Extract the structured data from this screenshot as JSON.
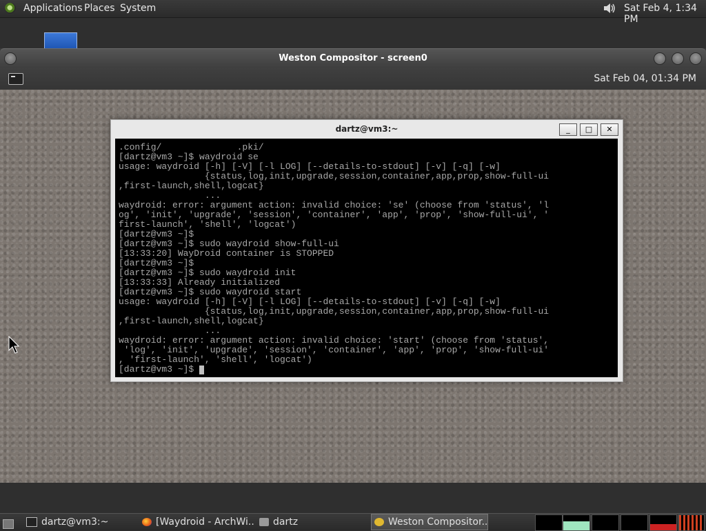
{
  "top_panel": {
    "menus": [
      "Applications",
      "Places",
      "System"
    ],
    "clock": "Sat Feb  4,  1:34 PM"
  },
  "weston": {
    "title": "Weston Compositor - screen0",
    "panel_clock": "Sat Feb 04, 01:34 PM"
  },
  "terminal": {
    "title": "dartz@vm3:~",
    "buttons": {
      "minimize": "_",
      "maximize": "□",
      "close": "✕"
    },
    "lines": [
      ".config/              .pki/",
      "[dartz@vm3 ~]$ waydroid se",
      "usage: waydroid [-h] [-V] [-l LOG] [--details-to-stdout] [-v] [-q] [-w]",
      "                {status,log,init,upgrade,session,container,app,prop,show-full-ui",
      ",first-launch,shell,logcat}",
      "                ...",
      "waydroid: error: argument action: invalid choice: 'se' (choose from 'status', 'l",
      "og', 'init', 'upgrade', 'session', 'container', 'app', 'prop', 'show-full-ui', '",
      "first-launch', 'shell', 'logcat')",
      "[dartz@vm3 ~]$",
      "[dartz@vm3 ~]$ sudo waydroid show-full-ui",
      "[13:33:20] WayDroid container is STOPPED",
      "[dartz@vm3 ~]$",
      "[dartz@vm3 ~]$ sudo waydroid init",
      "[13:33:33] Already initialized",
      "[dartz@vm3 ~]$ sudo waydroid start",
      "usage: waydroid [-h] [-V] [-l LOG] [--details-to-stdout] [-v] [-q] [-w]",
      "                {status,log,init,upgrade,session,container,app,prop,show-full-ui",
      ",first-launch,shell,logcat}",
      "                ...",
      "waydroid: error: argument action: invalid choice: 'start' (choose from 'status',",
      " 'log', 'init', 'upgrade', 'session', 'container', 'app', 'prop', 'show-full-ui'",
      ", 'first-launch', 'shell', 'logcat')"
    ],
    "prompt": "[dartz@vm3 ~]$ "
  },
  "taskbar": {
    "items": [
      {
        "label": "dartz@vm3:~",
        "icon": "terminal-icon"
      },
      {
        "label": "[Waydroid - ArchWi...",
        "icon": "firefox-icon"
      },
      {
        "label": "dartz",
        "icon": "folder-icon"
      },
      {
        "label": "Weston Compositor...",
        "icon": "weston-icon"
      }
    ]
  },
  "colors": {
    "terminal_bg": "#000000",
    "terminal_fg": "#a8a8a8",
    "desktop_bg": "#7d7670"
  }
}
